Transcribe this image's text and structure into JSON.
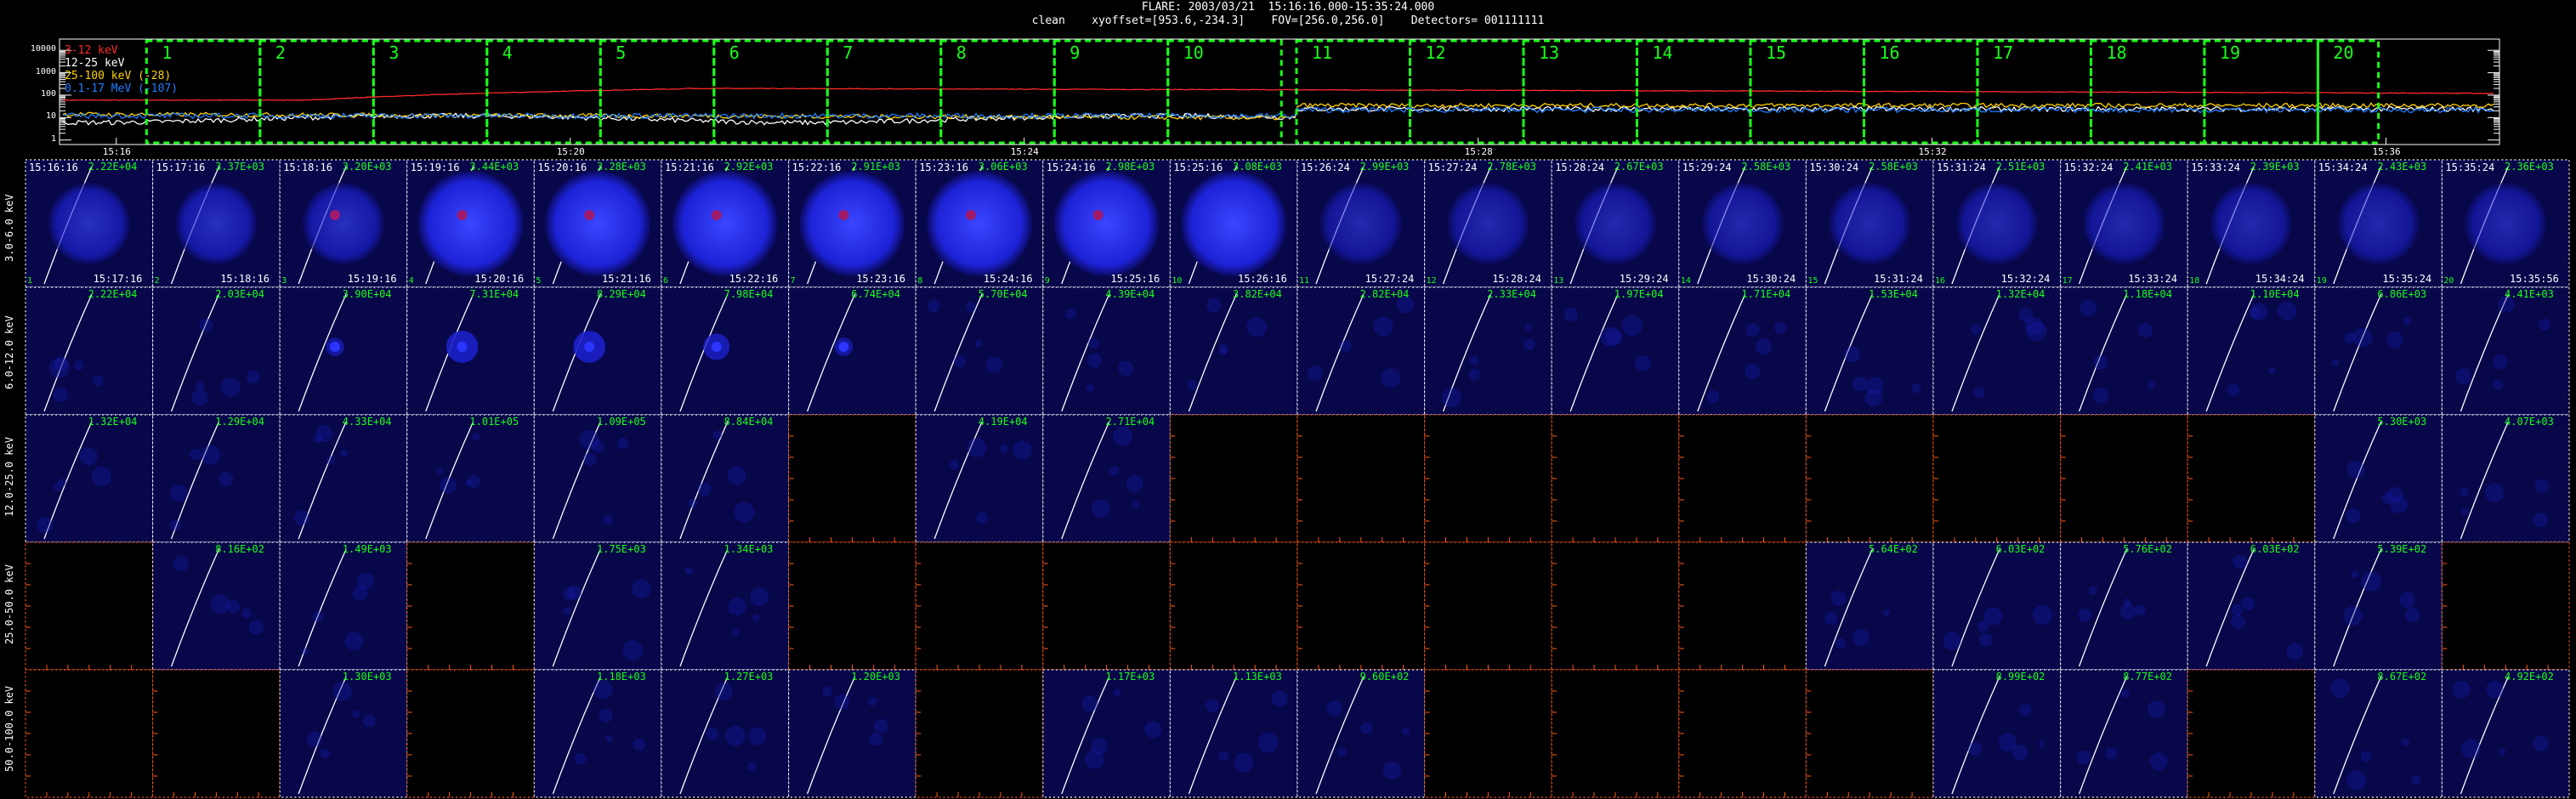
{
  "header": {
    "line1": "FLARE: 2003/03/21  15:16:16.000-15:35:24.000",
    "line2": "clean    xyoffset=[953.6,-234.3]    FOV=[256.0,256.0]    Detectors= 001111111"
  },
  "lightcurve": {
    "legend": [
      {
        "label": "3-12 keV",
        "color": "#ff2b2b"
      },
      {
        "label": "12-25 keV",
        "color": "#ffffff"
      },
      {
        "label": "25-100 keV (-28)",
        "color": "#ffd200"
      },
      {
        "label": "0.1-17 MeV (-107)",
        "color": "#1e7cff"
      }
    ],
    "y_ticks": [
      "10000",
      "1000",
      "100",
      "10",
      "1"
    ],
    "x_ticks": [
      "15:16",
      "15:20",
      "15:24",
      "15:28",
      "15:32",
      "15:36"
    ],
    "intervals": [
      "1",
      "2",
      "3",
      "4",
      "5",
      "6",
      "7",
      "8",
      "9",
      "10",
      "11",
      "12",
      "13",
      "14",
      "15",
      "16",
      "17",
      "18",
      "19",
      "20"
    ]
  },
  "rows": [
    {
      "label": "3.0-6.0 keV",
      "row_type": "start_end"
    },
    {
      "label": "6.0-12.0 keV",
      "row_type": "plain"
    },
    {
      "label": "12.0-25.0 keV",
      "row_type": "plain"
    },
    {
      "label": "25.0-50.0 keV",
      "row_type": "plain"
    },
    {
      "label": "50.0-100.0 keV",
      "row_type": "plain"
    }
  ],
  "start_times": [
    "15:16:16",
    "15:17:16",
    "15:18:16",
    "15:19:16",
    "15:20:16",
    "15:21:16",
    "15:22:16",
    "15:23:16",
    "15:24:16",
    "15:25:16",
    "15:26:24",
    "15:27:24",
    "15:28:24",
    "15:29:24",
    "15:30:24",
    "15:31:24",
    "15:32:24",
    "15:33:24",
    "15:34:24",
    "15:35:24"
  ],
  "end_times": [
    "15:17:16",
    "15:18:16",
    "15:19:16",
    "15:20:16",
    "15:21:16",
    "15:22:16",
    "15:23:16",
    "15:24:16",
    "15:25:16",
    "15:26:16",
    "15:27:24",
    "15:28:24",
    "15:29:24",
    "15:30:24",
    "15:31:24",
    "15:32:24",
    "15:33:24",
    "15:34:24",
    "15:35:24",
    "15:35:56"
  ],
  "panel_index": [
    "1",
    "2",
    "3",
    "4",
    "5",
    "6",
    "7",
    "8",
    "9",
    "10",
    "11",
    "12",
    "13",
    "14",
    "15",
    "16",
    "17",
    "18",
    "19",
    "20"
  ],
  "peaks": [
    [
      "2.22E+04",
      "3.37E+03",
      "3.20E+03",
      "3.44E+03",
      "3.28E+03",
      "2.92E+03",
      "2.91E+03",
      "3.06E+03",
      "2.98E+03",
      "3.08E+03",
      "2.99E+03",
      "2.78E+03",
      "2.67E+03",
      "2.58E+03",
      "2.58E+03",
      "2.51E+03",
      "2.41E+03",
      "2.39E+03",
      "2.43E+03",
      "2.36E+03"
    ],
    [
      "2.22E+04",
      "2.03E+04",
      "3.90E+04",
      "7.31E+04",
      "8.29E+04",
      "7.98E+04",
      "6.74E+04",
      "5.70E+04",
      "4.39E+04",
      "3.82E+04",
      "2.82E+04",
      "2.33E+04",
      "1.97E+04",
      "1.71E+04",
      "1.53E+04",
      "1.32E+04",
      "1.18E+04",
      "1.10E+04",
      "6.86E+03",
      "4.41E+03"
    ],
    [
      "1.32E+04",
      "1.29E+04",
      "4.33E+04",
      "1.01E+05",
      "1.09E+05",
      "8.84E+04",
      "",
      "4.19E+04",
      "2.71E+04",
      "",
      "",
      "",
      "",
      "",
      "",
      "",
      "",
      "",
      "5.30E+03",
      "4.07E+03"
    ],
    [
      "",
      "8.16E+02",
      "1.49E+03",
      "",
      "1.75E+03",
      "1.34E+03",
      "",
      "",
      "",
      "",
      "",
      "",
      "",
      "",
      "5.64E+02",
      "6.03E+02",
      "5.76E+02",
      "6.03E+02",
      "5.39E+02",
      ""
    ],
    [
      "",
      "",
      "1.30E+03",
      "",
      "1.18E+03",
      "1.27E+03",
      "1.20E+03",
      "",
      "1.17E+03",
      "1.13E+03",
      "9.60E+02",
      "",
      "",
      "",
      "",
      "8.99E+02",
      "8.77E+02",
      "",
      "8.67E+02",
      "4.92E+02"
    ]
  ],
  "colors": {
    "frame_ok": "#ffffff",
    "frame_empty": "#ff5a1a",
    "peak": "#19ff19",
    "interval_box": "#19ff19"
  }
}
